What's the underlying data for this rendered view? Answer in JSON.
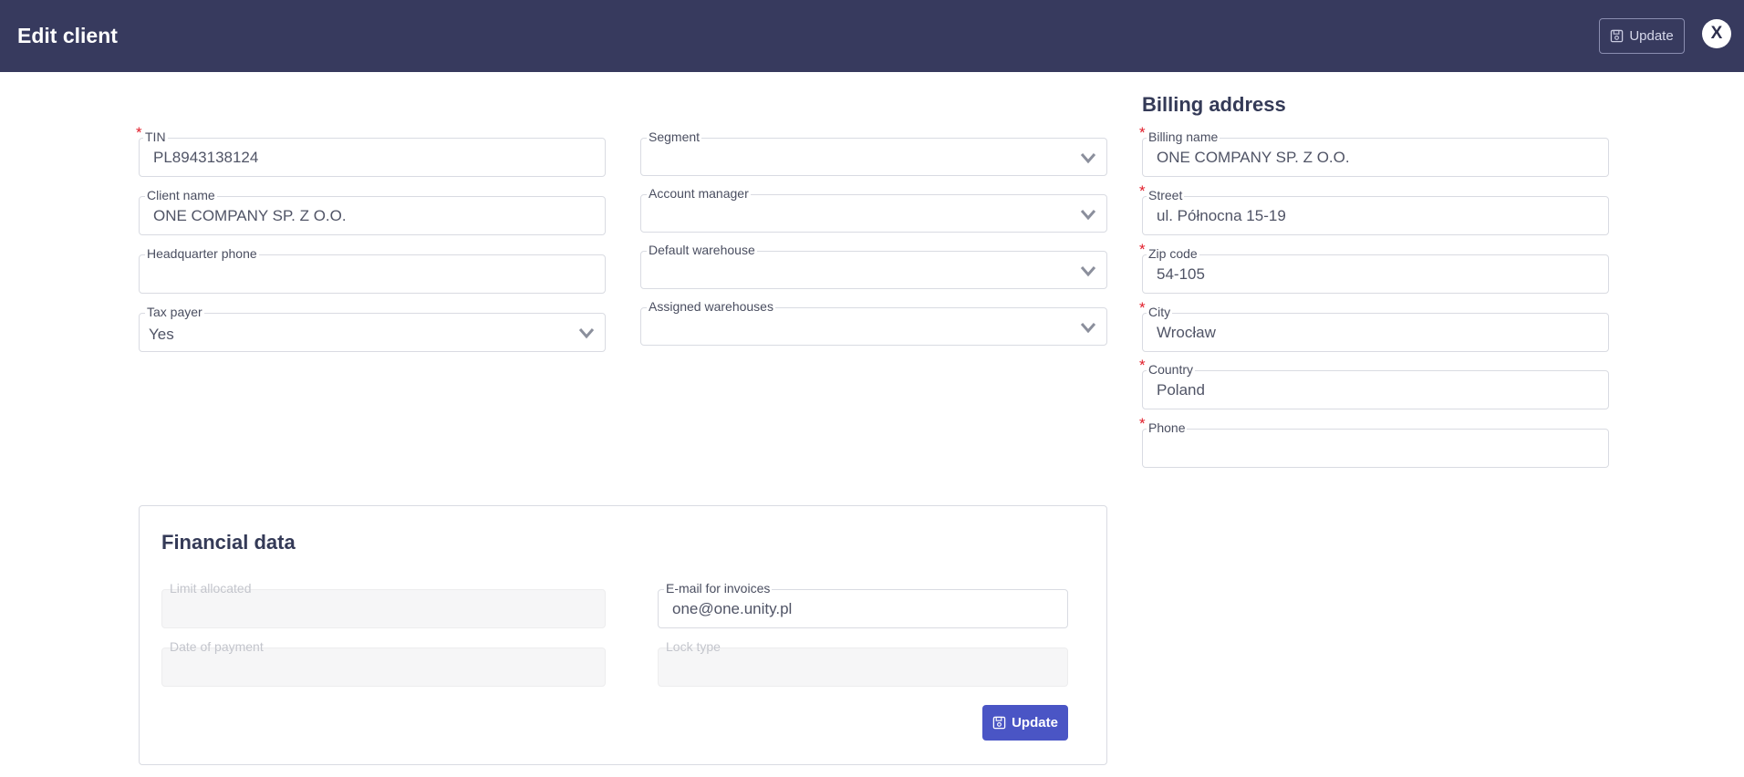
{
  "header": {
    "title": "Edit client",
    "update_label": "Update",
    "close_label": "X"
  },
  "client": {
    "tin": {
      "label": "TIN",
      "value": "PL8943138124",
      "required": true
    },
    "client_name": {
      "label": "Client name",
      "value": "ONE COMPANY SP. Z O.O."
    },
    "hq_phone": {
      "label": "Headquarter phone",
      "value": ""
    },
    "tax_payer": {
      "label": "Tax payer",
      "value": "Yes"
    },
    "segment": {
      "label": "Segment",
      "value": ""
    },
    "account_manager": {
      "label": "Account manager",
      "value": ""
    },
    "default_warehouse": {
      "label": "Default warehouse",
      "value": ""
    },
    "assigned_warehouses": {
      "label": "Assigned warehouses",
      "value": ""
    }
  },
  "billing": {
    "title": "Billing address",
    "billing_name": {
      "label": "Billing name",
      "value": "ONE COMPANY SP. Z O.O."
    },
    "street": {
      "label": "Street",
      "value": "ul. Północna 15-19"
    },
    "zip": {
      "label": "Zip code",
      "value": "54-105"
    },
    "city": {
      "label": "City",
      "value": "Wrocław"
    },
    "country": {
      "label": "Country",
      "value": "Poland"
    },
    "phone": {
      "label": "Phone",
      "value": ""
    }
  },
  "financial": {
    "title": "Financial data",
    "limit_allocated": {
      "label": "Limit allocated",
      "value": ""
    },
    "email_invoices": {
      "label": "E-mail for invoices",
      "value": "one@one.unity.pl"
    },
    "date_of_payment": {
      "label": "Date of payment",
      "value": ""
    },
    "lock_type": {
      "label": "Lock type",
      "value": ""
    },
    "update_label": "Update"
  },
  "colors": {
    "header_bg": "#373a5e",
    "primary_button": "#4a55c5",
    "required_marker": "#e11d2a"
  },
  "icons": {
    "save": "floppy-disk-icon",
    "chevron": "chevron-down-icon"
  }
}
